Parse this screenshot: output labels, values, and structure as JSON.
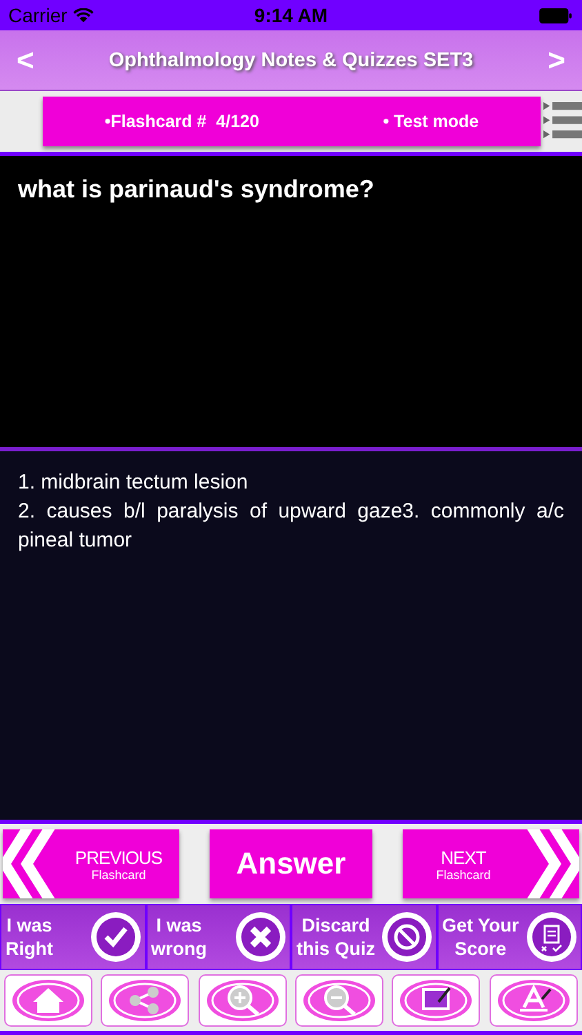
{
  "status_bar": {
    "carrier": "Carrier",
    "time": "9:14 AM"
  },
  "header": {
    "back": "<",
    "title": "Ophthalmology Notes & Quizzes SET3",
    "forward": ">"
  },
  "info_bar": {
    "flashcard": "•Flashcard #  4/120",
    "mode": "• Test mode"
  },
  "question": "what is parinaud's syndrome?",
  "answer_lines": [
    "1. midbrain tectum lesion",
    "2. causes b/l paralysis of upward gaze3. commonly a/c pineal tumor"
  ],
  "nav_buttons": [
    {
      "kind": "previous",
      "label": "PREVIOUS",
      "sub": "Flashcard"
    },
    {
      "kind": "answer",
      "label": "Answer"
    },
    {
      "kind": "next",
      "label": "NEXT",
      "sub": "Flashcard"
    }
  ],
  "actions": [
    {
      "kind": "check",
      "line1": "I was",
      "line2": "Right"
    },
    {
      "kind": "cross",
      "line1": "I was",
      "line2": "wrong"
    },
    {
      "kind": "ban",
      "line1": "Discard",
      "line2": "this Quiz"
    },
    {
      "kind": "score",
      "line1": "Get Your",
      "line2": "Score"
    }
  ],
  "toolbar": [
    {
      "kind": "home"
    },
    {
      "kind": "share"
    },
    {
      "kind": "zoom-in"
    },
    {
      "kind": "zoom-out"
    },
    {
      "kind": "draw"
    },
    {
      "kind": "font"
    }
  ]
}
